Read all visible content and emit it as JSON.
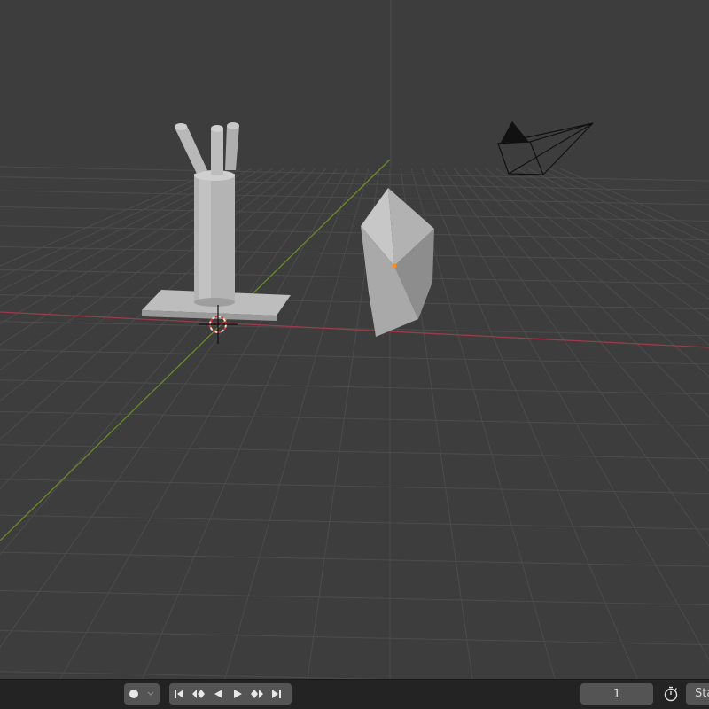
{
  "viewport": {
    "objects": [
      "pen-holder-mesh",
      "crystal-mesh",
      "camera-object",
      "3d-cursor"
    ]
  },
  "timeline": {
    "record_icon": "record-dot-icon",
    "keyframe_dropdown_icon": "chevron-down-icon",
    "playback_icons": [
      "jump-to-start-icon",
      "prev-keyframe-icon",
      "play-reverse-icon",
      "play-icon",
      "next-keyframe-icon",
      "jump-to-end-icon"
    ],
    "current_frame": "1",
    "stopwatch_icon": "stopwatch-icon",
    "start_label": "Start"
  },
  "colors": {
    "viewport_bg": "#3d3d3d",
    "grid": "#4d4d4d",
    "x_axis": "#9b3b4a",
    "y_axis": "#6b8a2a",
    "mesh_light": "#c4c4c4",
    "mesh_dark": "#8e8e8e",
    "origin": "#ff8c1a"
  }
}
